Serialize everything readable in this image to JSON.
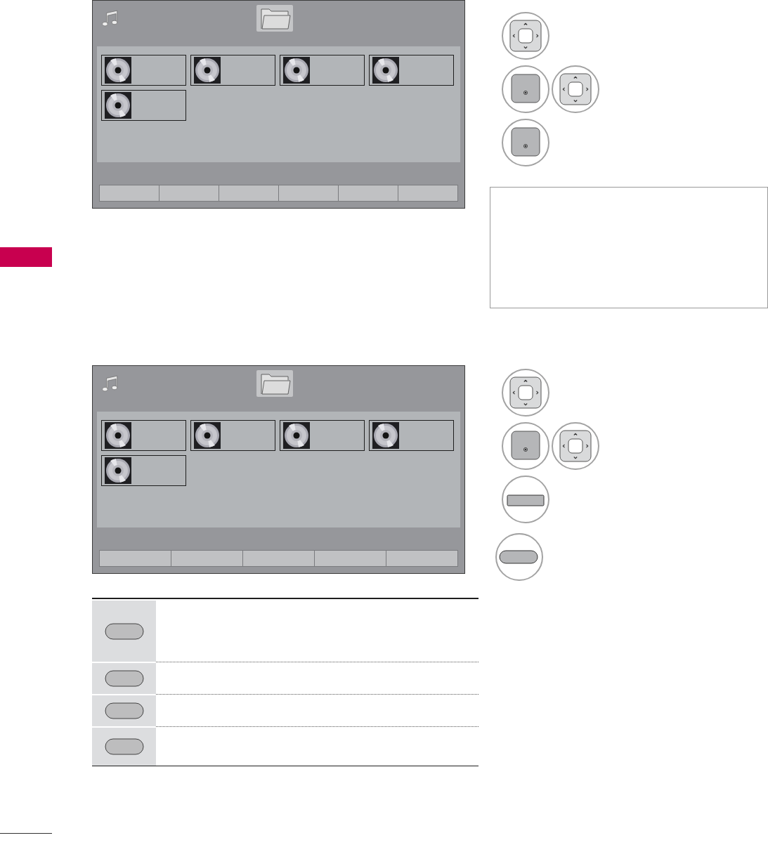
{
  "sections": [
    {
      "screen": {
        "tiles": [
          {
            "kind": "album"
          },
          {
            "kind": "album"
          },
          {
            "kind": "album"
          },
          {
            "kind": "album"
          },
          {
            "kind": "album"
          }
        ],
        "footer_buttons": [
          {
            "kind": "blank"
          },
          {
            "kind": "blank"
          },
          {
            "kind": "blank"
          },
          {
            "kind": "blank"
          },
          {
            "kind": "blank"
          },
          {
            "kind": "blank"
          }
        ]
      },
      "steps": [
        {
          "keys": [
            {
              "kind": "dpad"
            }
          ]
        },
        {
          "keys": [
            {
              "kind": "ok"
            },
            {
              "kind": "dpad"
            }
          ]
        },
        {
          "keys": [
            {
              "kind": "ok"
            }
          ]
        }
      ],
      "note_box": true
    },
    {
      "screen": {
        "tiles": [
          {
            "kind": "album"
          },
          {
            "kind": "album"
          },
          {
            "kind": "album"
          },
          {
            "kind": "album"
          },
          {
            "kind": "album"
          }
        ],
        "footer_buttons": [
          {
            "kind": "blank"
          },
          {
            "kind": "blank"
          },
          {
            "kind": "blank"
          },
          {
            "kind": "blank"
          },
          {
            "kind": "blank"
          }
        ]
      },
      "steps": [
        {
          "keys": [
            {
              "kind": "dpad"
            }
          ]
        },
        {
          "keys": [
            {
              "kind": "ok"
            },
            {
              "kind": "dpad"
            }
          ]
        },
        {
          "keys": [
            {
              "kind": "rect"
            }
          ]
        },
        {
          "keys": [
            {
              "kind": "oval"
            }
          ]
        }
      ],
      "key_table": {
        "rows": [
          {
            "kind": "oval"
          },
          {
            "kind": "oval"
          },
          {
            "kind": "oval"
          },
          {
            "kind": "oval"
          }
        ]
      }
    }
  ]
}
